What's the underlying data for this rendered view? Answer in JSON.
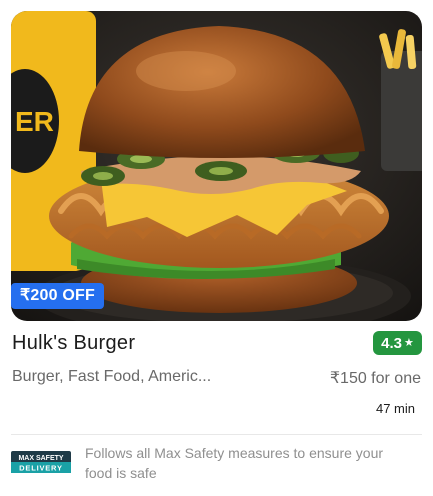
{
  "restaurant": {
    "name": "Hulk's Burger",
    "rating": "4.3",
    "rating_color": "#24963f",
    "star_icon": "star-icon",
    "cuisines": "Burger, Fast Food, Americ...",
    "price": "₹150 for one",
    "delivery_time": "47 min"
  },
  "offer": {
    "label": "₹200 OFF",
    "color": "#256fef"
  },
  "safety": {
    "logo_line1": "MAX SAFETY",
    "logo_line2": "DELIVERY",
    "text": "Follows all Max Safety measures to ensure your food is safe"
  }
}
